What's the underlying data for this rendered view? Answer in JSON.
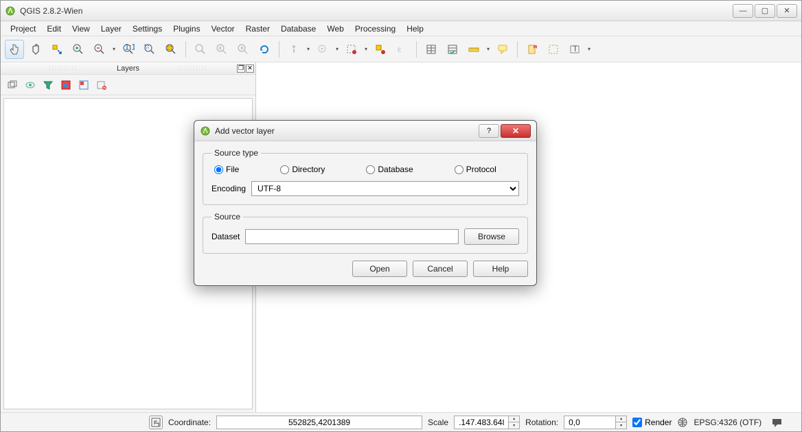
{
  "window": {
    "title": "QGIS 2.8.2-Wien"
  },
  "menu": [
    "Project",
    "Edit",
    "View",
    "Layer",
    "Settings",
    "Plugins",
    "Vector",
    "Raster",
    "Database",
    "Web",
    "Processing",
    "Help"
  ],
  "layers_panel": {
    "title": "Layers"
  },
  "dialog": {
    "title": "Add vector layer",
    "groups": {
      "source_type": "Source type",
      "source": "Source"
    },
    "radios": {
      "file": "File",
      "directory": "Directory",
      "database": "Database",
      "protocol": "Protocol"
    },
    "encoding_label": "Encoding",
    "encoding_value": "UTF-8",
    "dataset_label": "Dataset",
    "dataset_value": "",
    "browse": "Browse",
    "open": "Open",
    "cancel": "Cancel",
    "help": "Help"
  },
  "statusbar": {
    "coordinate_label": "Coordinate:",
    "coordinate_value": "552825,4201389",
    "scale_label": "Scale",
    "scale_value": ".147.483.648",
    "rotation_label": "Rotation:",
    "rotation_value": "0,0",
    "render_label": "Render",
    "crs_label": "EPSG:4326 (OTF)"
  }
}
